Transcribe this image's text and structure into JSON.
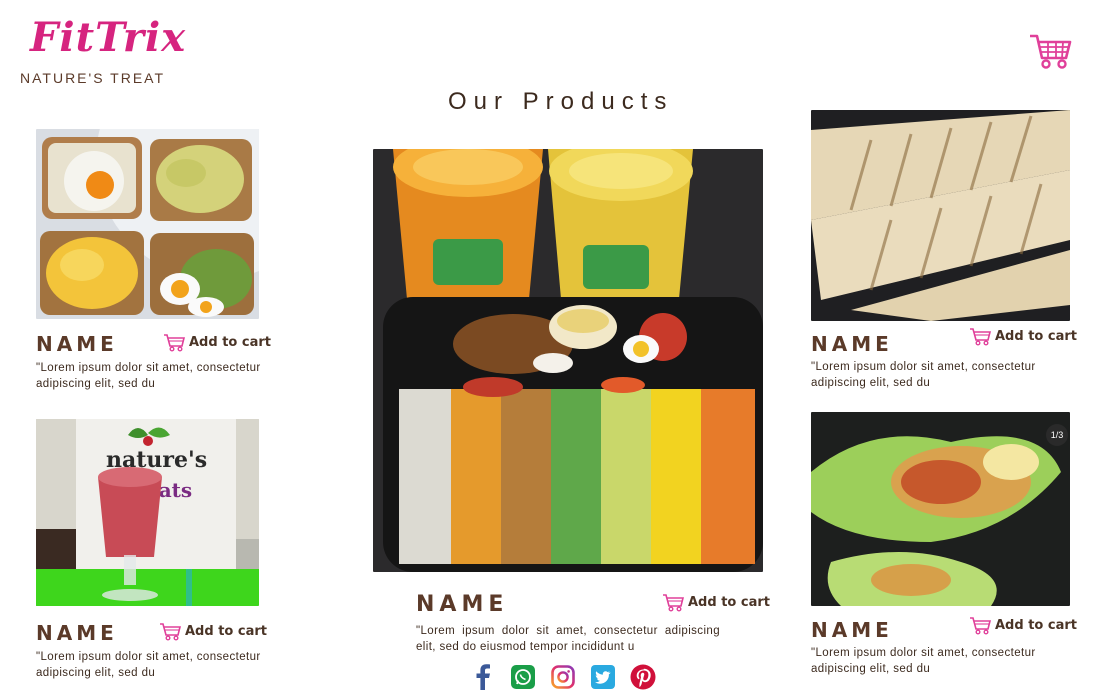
{
  "brand": {
    "name": "FitTrix",
    "tagline": "NATURE'S TREAT",
    "accent": "#d6247f"
  },
  "header": {
    "cart_icon": "shopping-cart-icon"
  },
  "section": {
    "title": "Our Products"
  },
  "products": [
    {
      "name": "NAME",
      "add_to_cart": "Add to cart",
      "description": "\"Lorem ipsum dolor sit amet, consectetur adipiscing elit, sed du",
      "image": "toast-eggs-avocado"
    },
    {
      "name": "NAME",
      "add_to_cart": "Add to cart",
      "description": "\"Lorem ipsum dolor sit amet, consectetur adipiscing elit, sed du",
      "image": "berry-smoothie"
    },
    {
      "name": "NAME",
      "add_to_cart": "Add to cart",
      "description": "\"Lorem ipsum dolor sit amet, consectetur adipiscing elit, sed do eiusmod tempor incididunt u",
      "image": "juices-and-salad-bowl"
    },
    {
      "name": "NAME",
      "add_to_cart": "Add to cart",
      "description": "\"Lorem ipsum dolor sit amet, consectetur adipiscing elit, sed du",
      "image": "grilled-wraps"
    },
    {
      "name": "NAME",
      "add_to_cart": "Add to cart",
      "description": "\"Lorem ipsum dolor sit amet, consectetur adipiscing elit, sed du",
      "image": "lettuce-wraps",
      "badge": "1/3"
    }
  ],
  "social": [
    {
      "icon": "facebook-icon",
      "color": "#3b5998"
    },
    {
      "icon": "whatsapp-icon",
      "color": "#1a9e48"
    },
    {
      "icon": "instagram-icon",
      "color": "#e1306c"
    },
    {
      "icon": "twitter-icon",
      "color": "#2aa9e0"
    },
    {
      "icon": "pinterest-icon",
      "color": "#d0103a"
    }
  ]
}
